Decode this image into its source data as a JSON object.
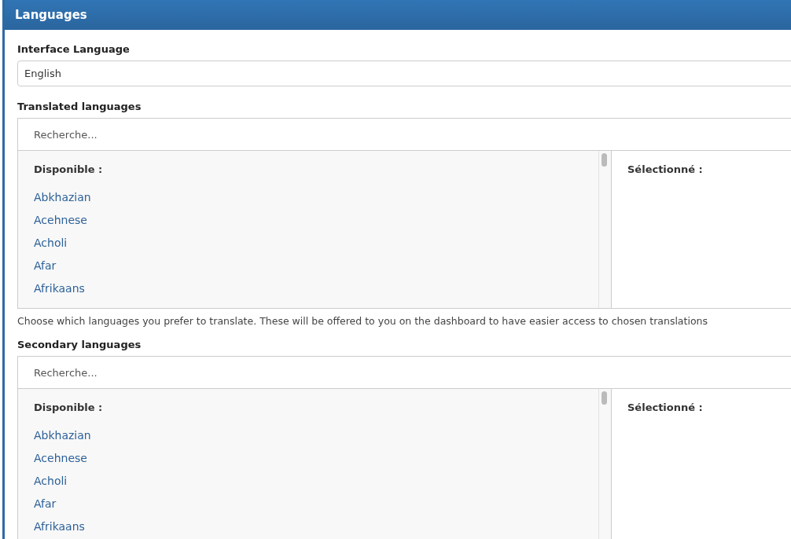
{
  "panel": {
    "title": "Languages"
  },
  "interface_language": {
    "label": "Interface Language",
    "value": "English"
  },
  "sections": [
    {
      "label": "Translated languages",
      "search_placeholder": "Recherche...",
      "available_heading": "Disponible :",
      "selected_heading": "Sélectionné :",
      "available": [
        "Abkhazian",
        "Acehnese",
        "Acholi",
        "Afar",
        "Afrikaans"
      ],
      "help": "Choose which languages you prefer to translate. These will be offered to you on the dashboard to have easier access to chosen translations"
    },
    {
      "label": "Secondary languages",
      "search_placeholder": "Recherche...",
      "available_heading": "Disponible :",
      "selected_heading": "Sélectionné :",
      "available": [
        "Abkhazian",
        "Acehnese",
        "Acholi",
        "Afar",
        "Afrikaans"
      ]
    }
  ]
}
